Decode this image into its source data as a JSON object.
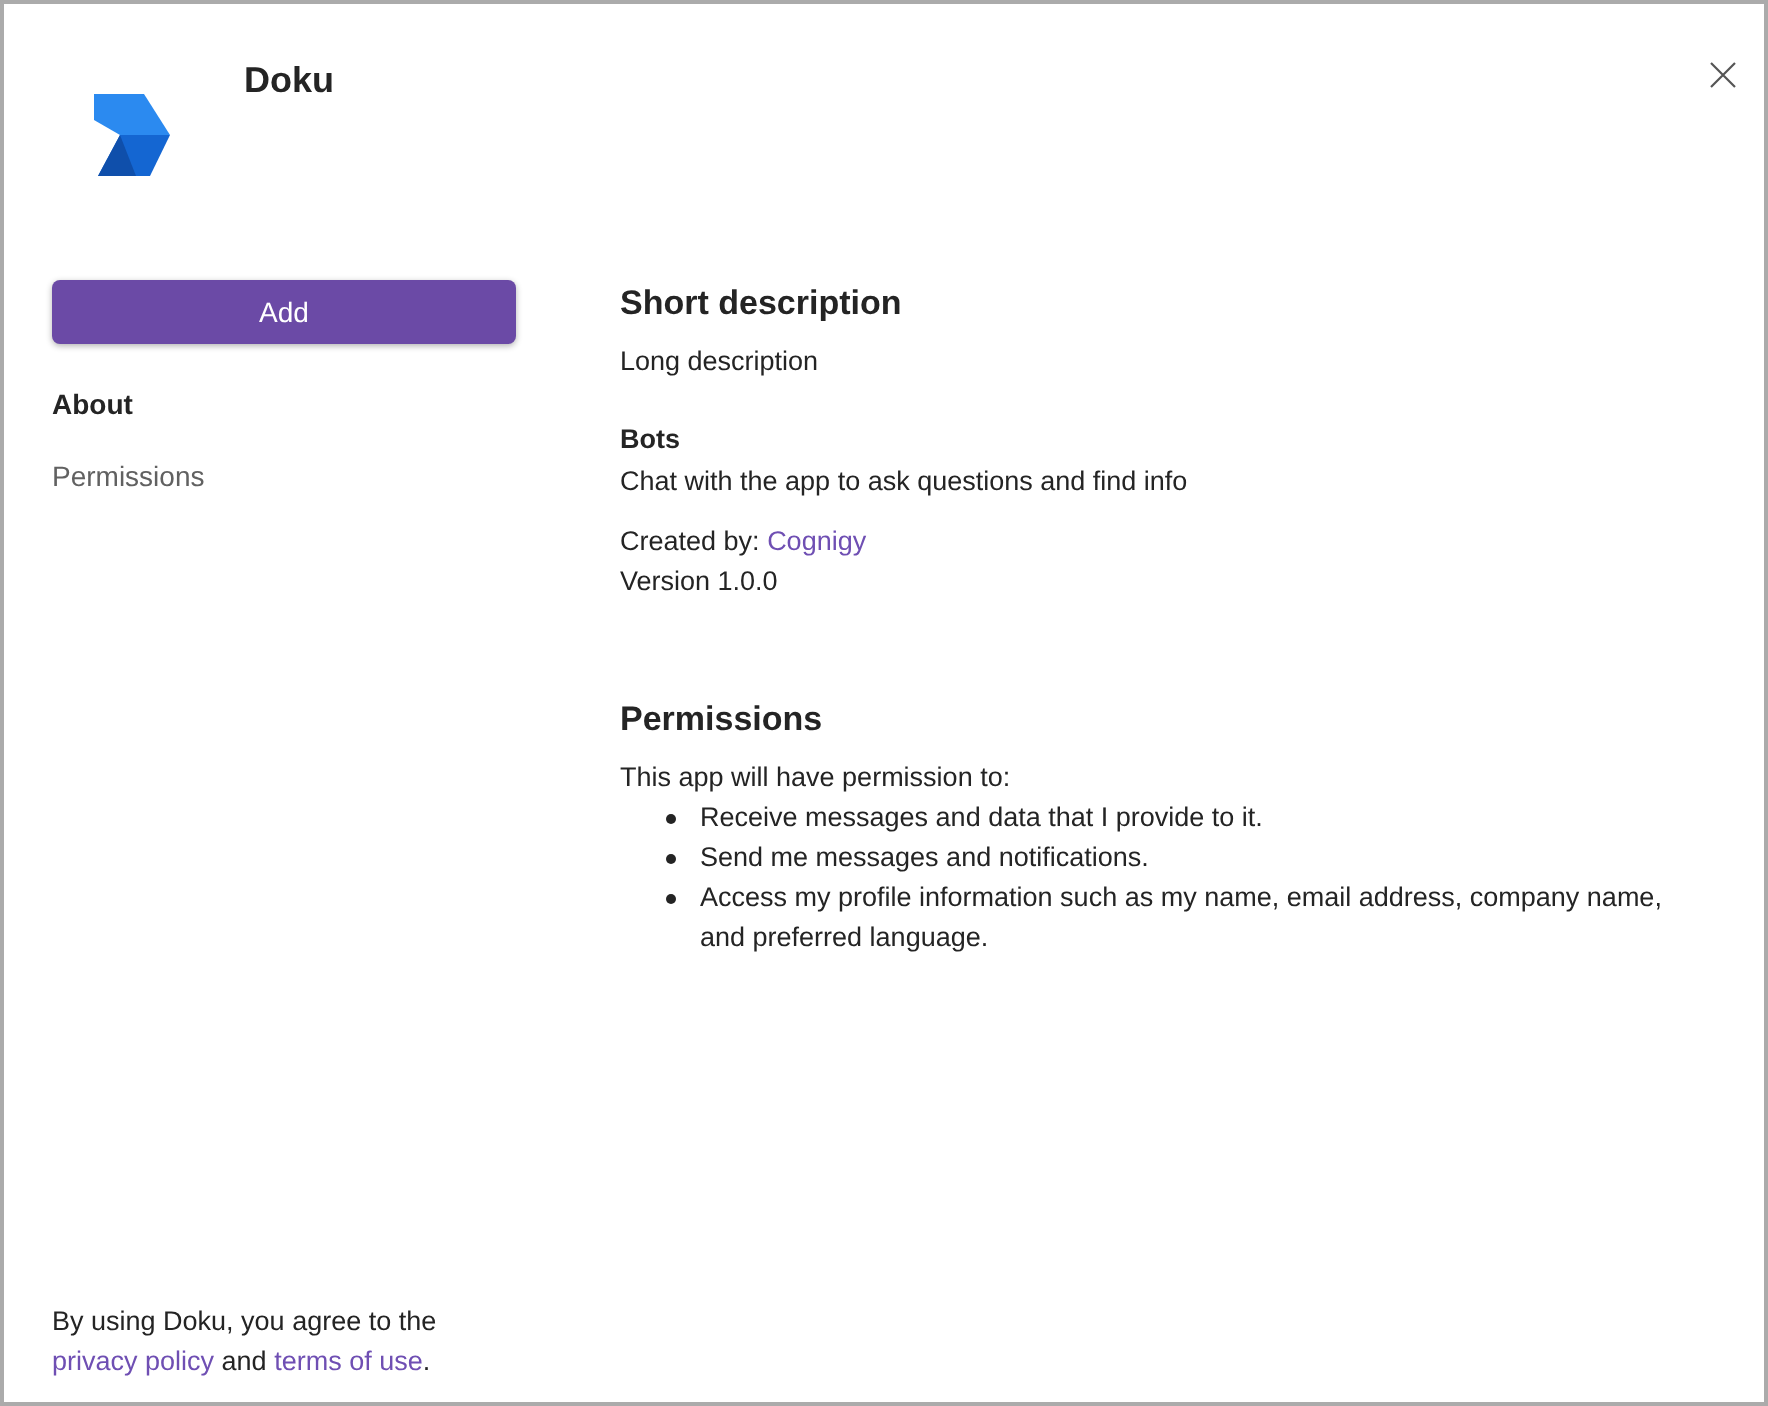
{
  "header": {
    "app_name": "Doku"
  },
  "add_button": {
    "label": "Add"
  },
  "nav": [
    {
      "label": "About",
      "selected": true
    },
    {
      "label": "Permissions",
      "selected": false
    }
  ],
  "about": {
    "heading": "Short description",
    "description": "Long description",
    "sections": [
      {
        "title": "Bots",
        "text": "Chat with the app to ask questions and find info"
      }
    ],
    "created_by": {
      "label": "Created by:",
      "link": "Cognigy"
    },
    "version": "Version 1.0.0"
  },
  "permissions": {
    "heading": "Permissions",
    "intro": "This app will have permission to:",
    "items": [
      "Receive messages and data that I provide to it.",
      "Send me messages and notifications.",
      "Access my profile information such as my name, email address, company name, and preferred language."
    ]
  },
  "footer": {
    "parts": [
      {
        "kind": "text",
        "text": "By using Doku, you agree to the "
      },
      {
        "kind": "link",
        "text": "privacy policy"
      },
      {
        "kind": "text",
        "text": " and "
      },
      {
        "kind": "link",
        "text": "terms of use"
      },
      {
        "kind": "text",
        "text": "."
      }
    ]
  }
}
